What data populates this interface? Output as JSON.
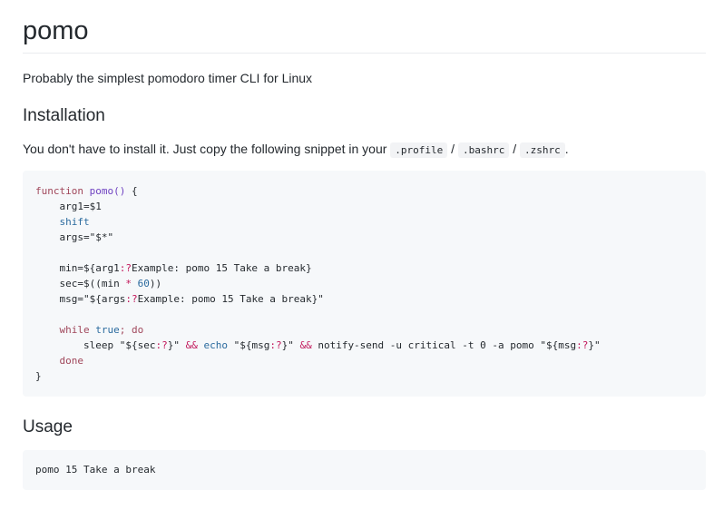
{
  "title": "pomo",
  "description": "Probably the simplest pomodoro timer CLI for Linux",
  "installation": {
    "heading": "Installation",
    "intro_text": "You don't have to install it. Just copy the following snippet in your",
    "files": [
      ".profile",
      ".bashrc",
      ".zshrc"
    ],
    "separator": "/",
    "end_punct": ".",
    "code": {
      "l1_kw": "function",
      "l1_fn": "pomo()",
      "l1_brace": " {",
      "l2": "arg1=$1",
      "l3": "shift",
      "l4": "args=\"$*\"",
      "l6a": "min=${arg1",
      "l6b": ":?",
      "l6c": "Example: pomo 15 Take a break}",
      "l7a": "sec=$((min ",
      "l7b": "*",
      "l7c": " ",
      "l7d": "60",
      "l7e": "))",
      "l8a": "msg=\"${args",
      "l8b": ":?",
      "l8c": "Example: pomo 15 Take a break}\"",
      "l10a": "while",
      "l10b": "true",
      "l10c": ";",
      "l10d": "do",
      "l11a": "sleep \"${sec",
      "l11b": ":?",
      "l11c": "}\" ",
      "l11d": "&&",
      "l11e": "echo",
      "l11f": " \"${msg",
      "l11g": ":?",
      "l11h": "}\" ",
      "l11i": "&&",
      "l11j": " notify-send -u critical -t 0 -a pomo \"${msg",
      "l11k": ":?",
      "l11l": "}\"",
      "l12": "done",
      "l13": "}"
    }
  },
  "usage": {
    "heading": "Usage",
    "code": "pomo 15 Take a break"
  }
}
